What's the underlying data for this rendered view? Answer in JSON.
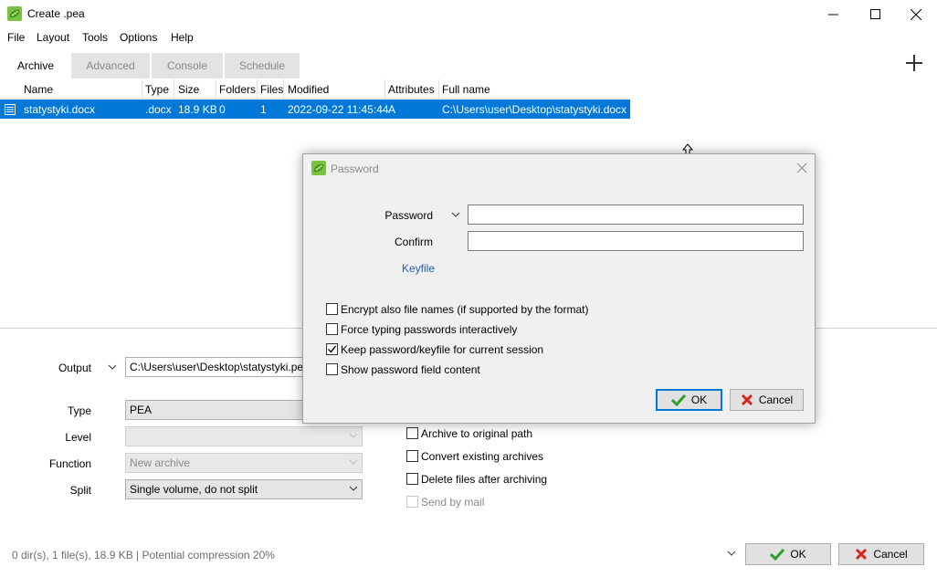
{
  "window": {
    "title": "Create .pea"
  },
  "menu": [
    "File",
    "Layout",
    "Tools",
    "Options",
    "Help"
  ],
  "tabs": [
    "Archive",
    "Advanced",
    "Console",
    "Schedule"
  ],
  "list": {
    "columns": [
      "Name",
      "Type",
      "Size",
      "Folders",
      "Files",
      "Modified",
      "Attributes",
      "Full name"
    ],
    "rows": [
      {
        "name": "statystyki.docx",
        "type": ".docx",
        "size": "18.9 KB",
        "folders": "0",
        "files": "1",
        "modified": "2022-09-22 11:45:44",
        "attributes": "A",
        "full_name": "C:\\Users\\user\\Desktop\\statystyki.docx"
      }
    ]
  },
  "form": {
    "output_label": "Output",
    "output_value": "C:\\Users\\user\\Desktop\\statystyki.pea",
    "type_label": "Type",
    "type_value": "PEA",
    "level_label": "Level",
    "level_value": "",
    "function_label": "Function",
    "function_value": "New archive",
    "split_label": "Split",
    "split_value": "Single volume, do not split",
    "options": [
      {
        "label": "Archive to original path",
        "checked": false,
        "enabled": true
      },
      {
        "label": "Convert existing archives",
        "checked": false,
        "enabled": true
      },
      {
        "label": "Delete files after archiving",
        "checked": false,
        "enabled": true
      },
      {
        "label": "Send by mail",
        "checked": false,
        "enabled": false
      }
    ]
  },
  "status": "0 dir(s), 1 file(s), 18.9 KB | Potential compression 20%",
  "main_buttons": {
    "ok": "OK",
    "cancel": "Cancel"
  },
  "dialog": {
    "title": "Password",
    "password_label": "Password",
    "confirm_label": "Confirm",
    "keyfile_link": "Keyfile",
    "checkboxes": [
      {
        "label": "Encrypt also file names (if supported by the format)",
        "checked": false
      },
      {
        "label": "Force typing passwords interactively",
        "checked": false
      },
      {
        "label": "Keep password/keyfile for current session",
        "checked": true
      },
      {
        "label": "Show password field content",
        "checked": false
      }
    ],
    "ok": "OK",
    "cancel": "Cancel"
  },
  "colors": {
    "selection": "#0078d7",
    "ok_green": "#2e9e2e",
    "cancel_red": "#d9241c",
    "link": "#1a5fb4"
  }
}
